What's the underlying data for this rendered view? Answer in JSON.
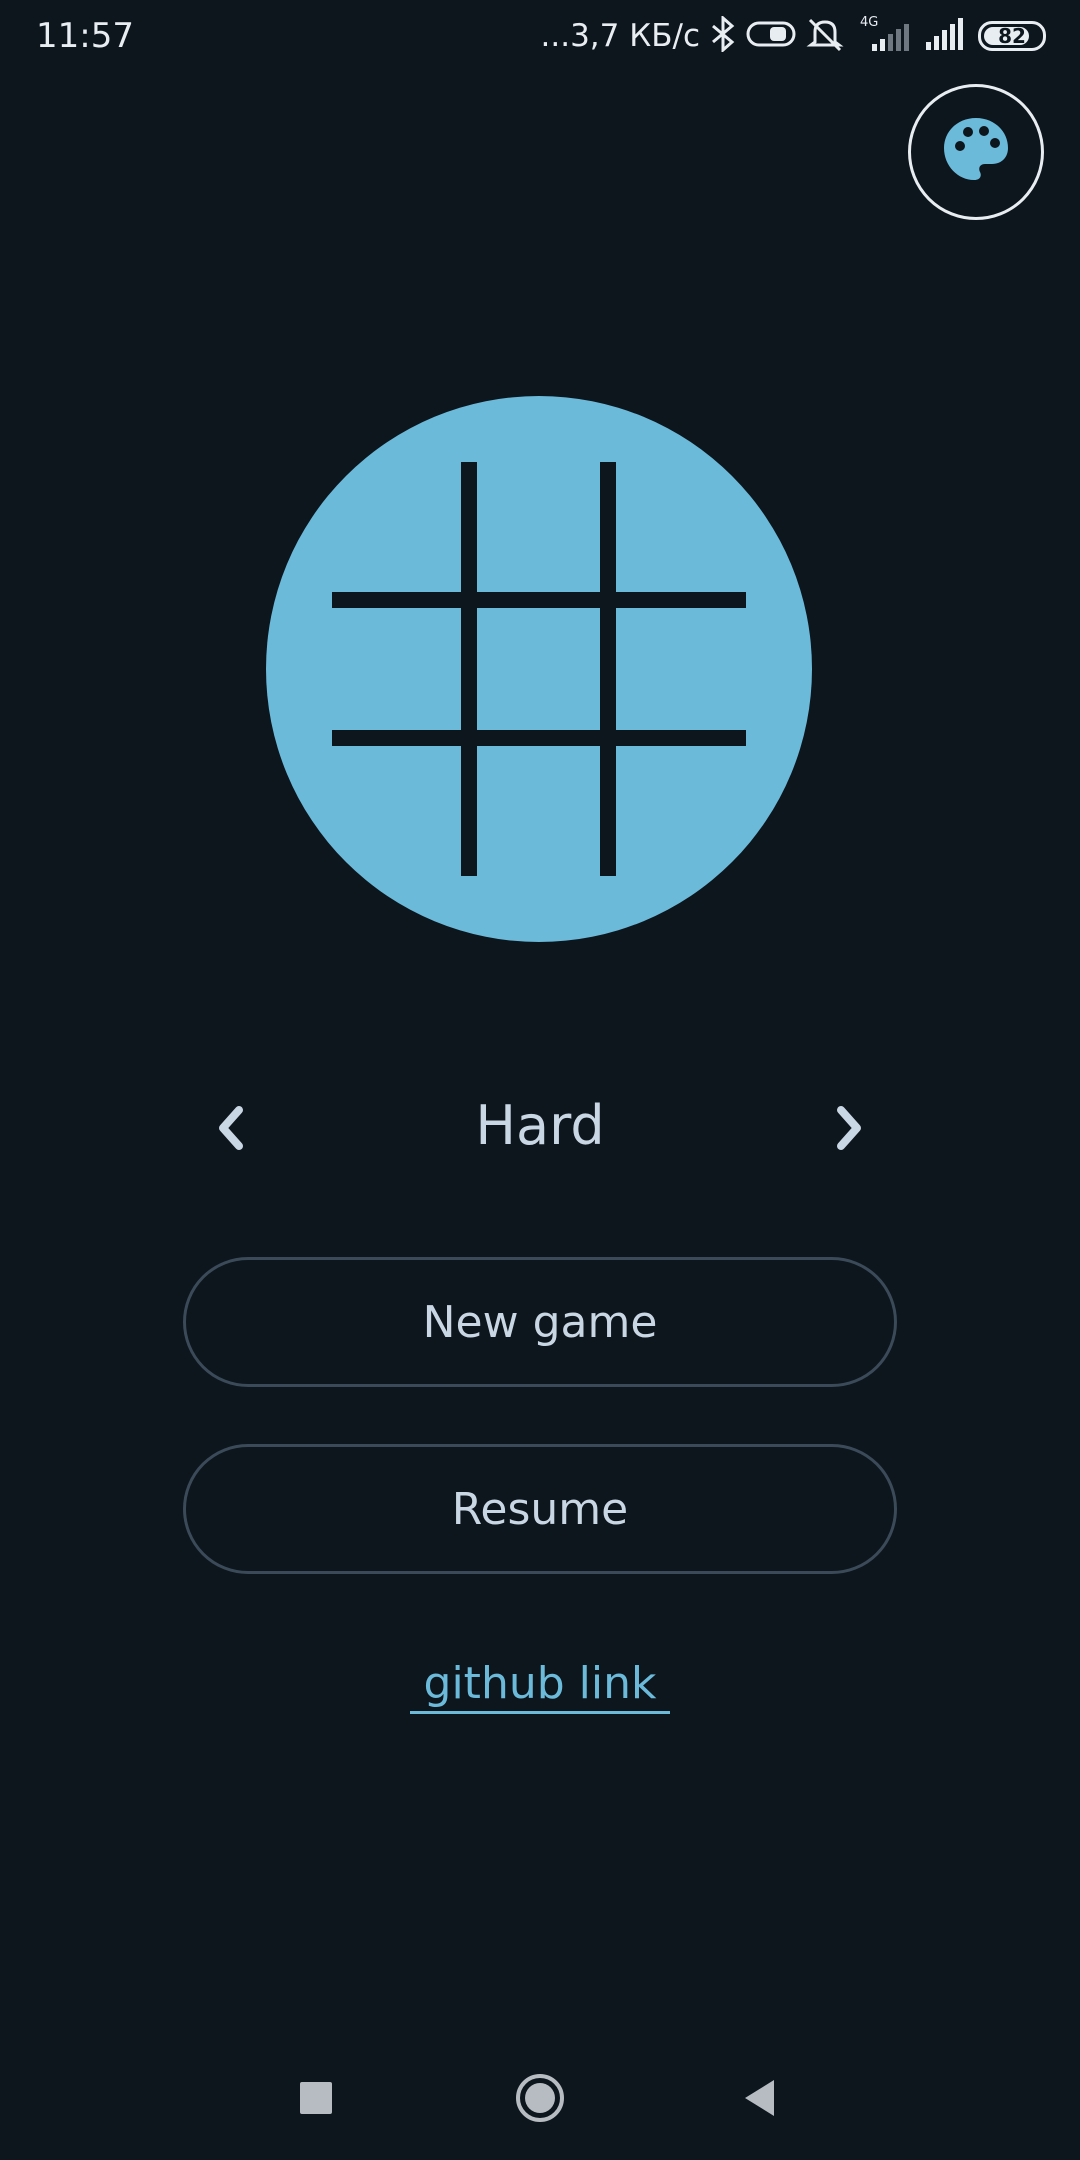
{
  "status_bar": {
    "time": "11:57",
    "network_speed": "...3,7 КБ/с",
    "network_type": "4G",
    "battery_level": "82",
    "icons": [
      "bluetooth-icon",
      "toggle-icon",
      "mute-icon",
      "signal-icon",
      "signal-icon",
      "battery-icon"
    ]
  },
  "header": {
    "theme_icon": "palette-icon"
  },
  "logo": {
    "icon": "tic-tac-toe-grid-icon",
    "color": "#6bbad9"
  },
  "difficulty": {
    "label": "Hard",
    "prev_icon": "chevron-left-icon",
    "next_icon": "chevron-right-icon"
  },
  "buttons": {
    "new_game": "New game",
    "resume": "Resume"
  },
  "footer": {
    "link_text": "github link"
  },
  "colors": {
    "background": "#0d151d",
    "accent": "#6bbad9",
    "text": "#c9d6e3",
    "button_border": "#3b4a58"
  }
}
